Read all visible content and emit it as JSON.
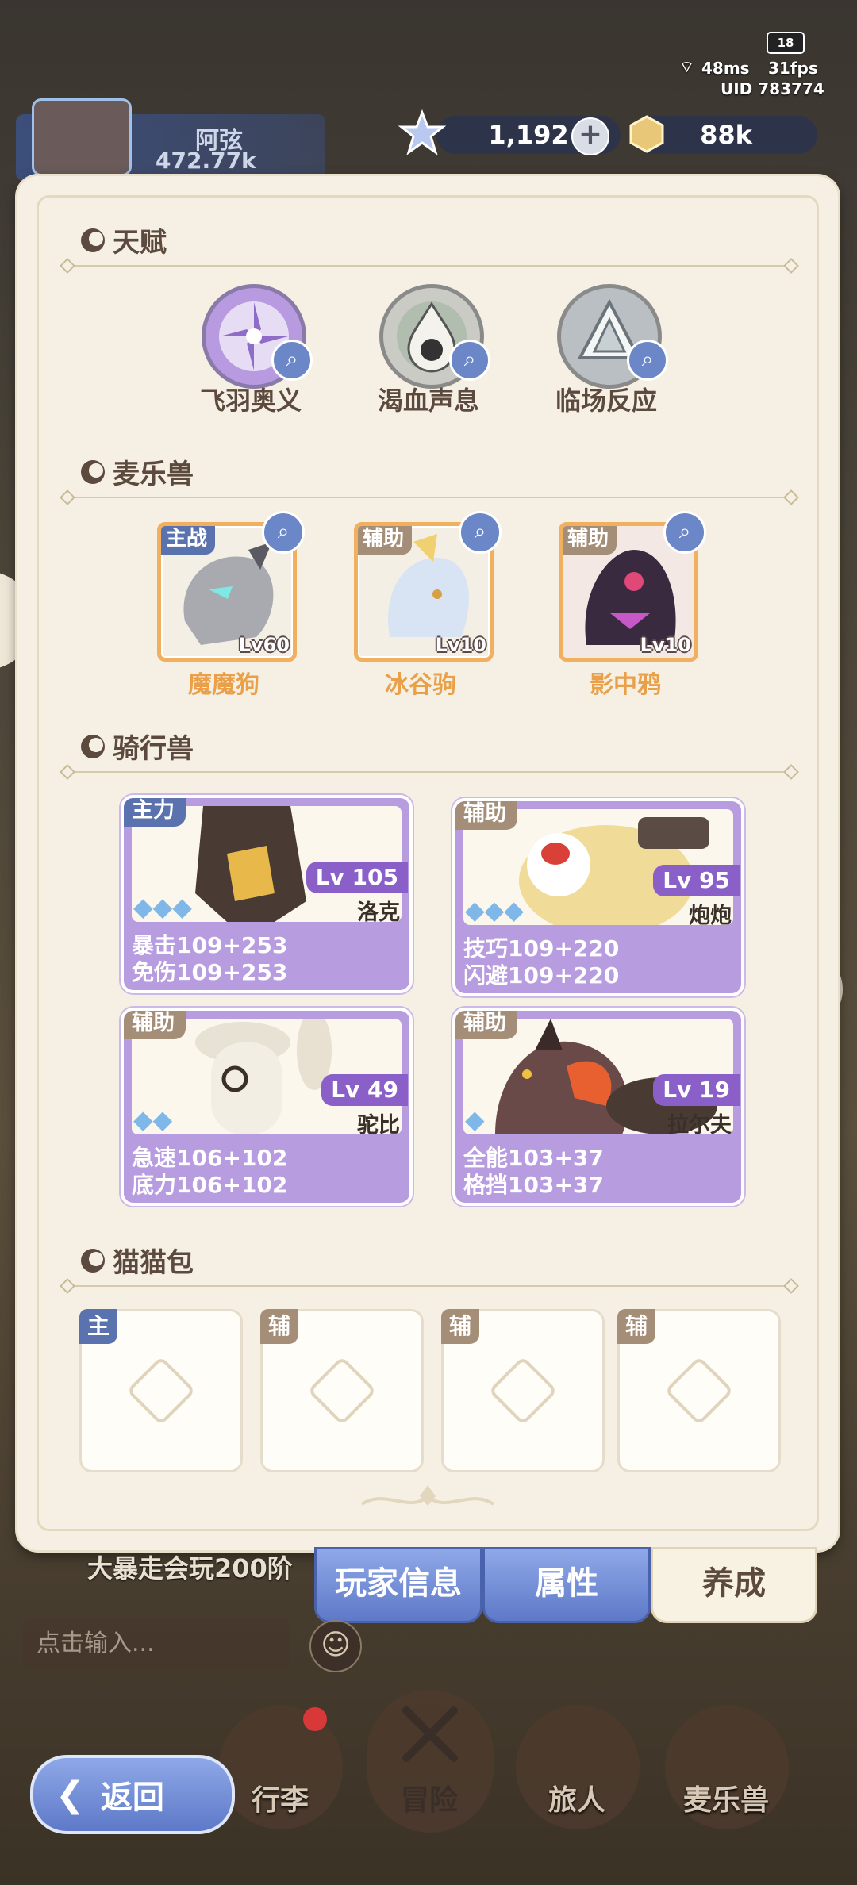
{
  "status": {
    "battery": "18",
    "ping": "48ms",
    "fps": "31fps",
    "uid": "UID 783774"
  },
  "player": {
    "name": "阿弦",
    "power": "472.77k"
  },
  "currency": {
    "stars": "1,192",
    "gold": "88k"
  },
  "talents": {
    "title": "天赋",
    "items": [
      {
        "label": "飞羽奥义",
        "icon": "feather-shuriken-icon",
        "color": "#b79ae0"
      },
      {
        "label": "渴血声息",
        "icon": "blood-drop-icon",
        "color": "#c9cbc4"
      },
      {
        "label": "临场反应",
        "icon": "crystal-reflex-icon",
        "color": "#b9bfc3"
      }
    ]
  },
  "pets": {
    "title": "麦乐兽",
    "items": [
      {
        "tag": "主战",
        "level": "Lv60",
        "name": "魔魔狗"
      },
      {
        "tag": "辅助",
        "level": "Lv10",
        "name": "冰谷驹"
      },
      {
        "tag": "辅助",
        "level": "Lv10",
        "name": "影中鸦"
      }
    ]
  },
  "mounts": {
    "title": "骑行兽",
    "items": [
      {
        "tag": "主力",
        "level": "Lv 105",
        "name": "洛克",
        "stars": "◆◆◆",
        "stat1": "暴击109+253",
        "stat2": "免伤109+253"
      },
      {
        "tag": "辅助",
        "level": "Lv 95",
        "name": "炮炮",
        "stars": "◆◆◆",
        "stat1": "技巧109+220",
        "stat2": "闪避109+220"
      },
      {
        "tag": "辅助",
        "level": "Lv 49",
        "name": "驼比",
        "stars": "◆◆",
        "stat1": "急速106+102",
        "stat2": "底力106+102"
      },
      {
        "tag": "辅助",
        "level": "Lv 19",
        "name": "拉尔夫",
        "stars": "◆",
        "stat1": "全能103+37",
        "stat2": "格挡103+37"
      }
    ]
  },
  "cat_bag": {
    "title": "猫猫包",
    "slots": [
      {
        "tag": "主"
      },
      {
        "tag": "辅"
      },
      {
        "tag": "辅"
      },
      {
        "tag": "辅"
      }
    ]
  },
  "tabs": {
    "player_info": "玩家信息",
    "attributes": "属性",
    "growth": "养成"
  },
  "chat": {
    "message": "大暴走会玩200阶",
    "input_placeholder": "点击输入..."
  },
  "nav": {
    "back": "返回",
    "bag": "行李",
    "adventure": "冒险",
    "traveler": "旅人",
    "pets": "麦乐兽"
  }
}
